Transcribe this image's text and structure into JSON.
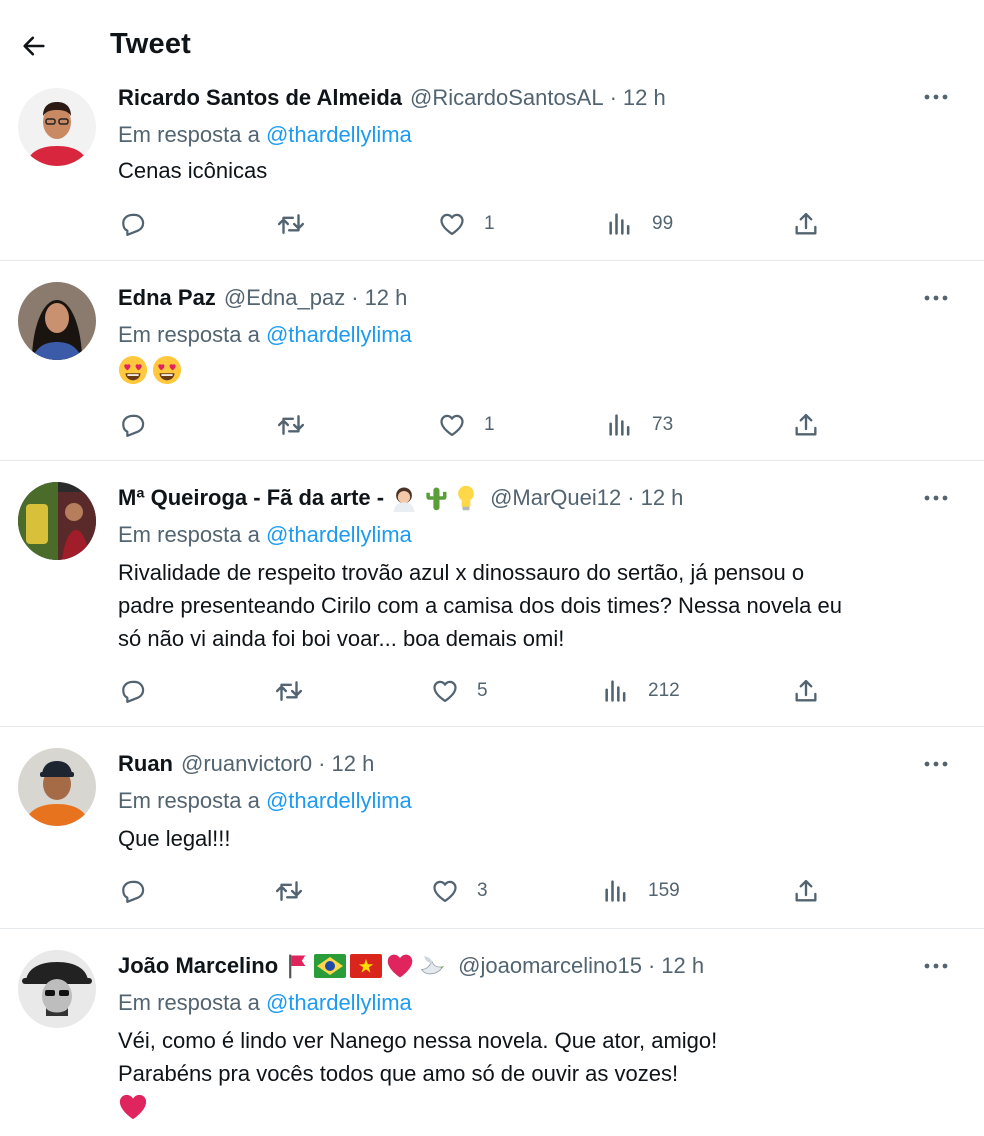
{
  "header": {
    "title": "Tweet",
    "back_icon": "arrow-left-icon"
  },
  "reply_prefix": "Em resposta a",
  "colors": {
    "accent": "#1d9bf0",
    "secondary_text": "#536471",
    "heart_red": "#e0245e"
  },
  "tweets": [
    {
      "name": "Ricardo Santos de Almeida",
      "handle": "@RicardoSantosAL",
      "separator": "·",
      "time": "12 h",
      "reply_to": "@thardellylima",
      "text": "Cenas icônicas",
      "likes": "1",
      "views": "99"
    },
    {
      "name": "Edna Paz",
      "handle": "@Edna_paz",
      "separator": "·",
      "time": "12 h",
      "reply_to": "@thardellylima",
      "emoji": [
        "heart-eyes-emoji",
        "heart-eyes-emoji"
      ],
      "likes": "1",
      "views": "73"
    },
    {
      "name": "Mª Queiroga - Fã da arte -",
      "name_emoji": [
        "woman-emoji",
        "cactus-emoji",
        "light-bulb-emoji"
      ],
      "handle": "@MarQuei12",
      "separator": "·",
      "time": "12 h",
      "reply_to": "@thardellylima",
      "text_lines": [
        "Rivalidade de respeito trovão azul x dinossauro do sertão, já pensou o",
        "padre presenteando Cirilo com a camisa dos dois times? Nessa novela eu",
        "só não vi ainda foi boi voar... boa demais omi!"
      ],
      "likes": "5",
      "views": "212"
    },
    {
      "name": "Ruan",
      "handle": "@ruanvictor0",
      "separator": "·",
      "time": "12 h",
      "reply_to": "@thardellylima",
      "text": "Que legal!!!",
      "likes": "3",
      "views": "159"
    },
    {
      "name": "João Marcelino",
      "name_emoji": [
        "red-flag-emoji",
        "brazil-flag-emoji",
        "vietnam-flag-emoji",
        "red-heart-emoji",
        "dove-emoji"
      ],
      "handle": "@joaomarcelino15",
      "separator": "·",
      "time": "12 h",
      "reply_to": "@thardellylima",
      "text_lines": [
        "Véi, como é lindo ver Nanego nessa novela. Que ator, amigo!",
        "Parabéns pra vocês todos que amo só de ouvir as vozes!"
      ],
      "trailing_emoji": "red-heart-emoji"
    }
  ]
}
